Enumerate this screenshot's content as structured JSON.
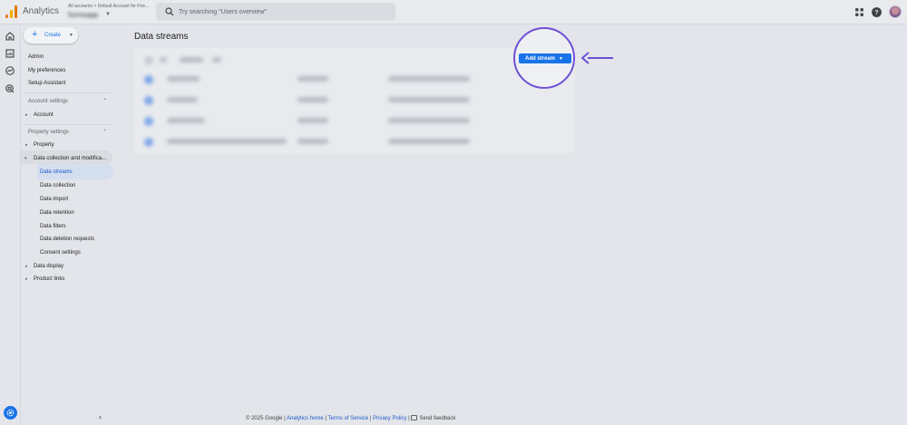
{
  "topbar": {
    "app_title": "Analytics",
    "account_path": "All accounts > Default Account for Fire...",
    "account_name": "formsapp",
    "search_placeholder": "Try searching \"Users overview\""
  },
  "sidebar": {
    "create_label": "Create",
    "top_items": [
      "Admin",
      "My preferences",
      "Setup Assistant"
    ],
    "account_settings": {
      "label": "Account settings",
      "items": [
        "Account"
      ]
    },
    "property_settings": {
      "label": "Property settings",
      "property": "Property",
      "data_collection_group": "Data collection and modifica...",
      "sub_items": [
        "Data streams",
        "Data collection",
        "Data import",
        "Data retention",
        "Data filters",
        "Data deletion requests",
        "Consent settings"
      ],
      "data_display": "Data display",
      "product_links": "Product links"
    }
  },
  "main": {
    "title": "Data streams",
    "add_stream_label": "Add stream",
    "rows_blurred": 4
  },
  "footer": {
    "copyright": "© 2025 Google |",
    "analytics_home": "Analytics home",
    "sep1": "|",
    "terms": "Terms of Service",
    "sep2": "|",
    "privacy": "Privacy Policy",
    "sep3": "|",
    "feedback": "Send feedback"
  },
  "colors": {
    "accent": "#1a73e8",
    "highlight_ring": "#6e4fd6",
    "background": "#e3e5ea"
  }
}
